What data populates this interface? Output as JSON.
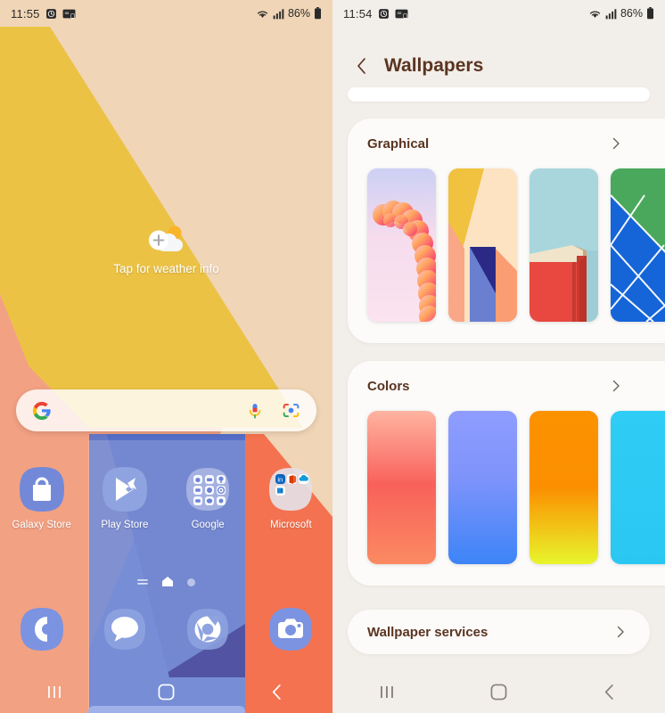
{
  "left_screen": {
    "name": "home-screen",
    "status_bar": {
      "time": "11:55",
      "battery_percent": "86%",
      "icons": [
        "alarm-icon",
        "data-saver-icon",
        "wifi-icon",
        "signal-icon",
        "battery-icon"
      ]
    },
    "weather_widget": {
      "label": "Tap for weather info",
      "icon": "weather-add-icon"
    },
    "search_bar": {
      "value": "",
      "placeholder": "",
      "icons": [
        "google-logo-icon",
        "microphone-icon",
        "google-lens-icon"
      ]
    },
    "apps": [
      {
        "label": "Galaxy Store",
        "icon": "galaxy-store-icon"
      },
      {
        "label": "Play Store",
        "icon": "play-store-icon"
      },
      {
        "label": "Google",
        "icon": "google-folder-icon"
      },
      {
        "label": "Microsoft",
        "icon": "microsoft-folder-icon"
      }
    ],
    "page_indicators": [
      "list-indicator",
      "home-indicator",
      "page-dot"
    ],
    "dock": [
      {
        "label": "Phone",
        "icon": "phone-icon"
      },
      {
        "label": "Messages",
        "icon": "messages-icon"
      },
      {
        "label": "Chrome",
        "icon": "chrome-icon"
      },
      {
        "label": "Camera",
        "icon": "camera-icon"
      }
    ],
    "nav_bar": [
      "recents-icon",
      "home-icon",
      "back-icon"
    ],
    "wallpaper_colors": {
      "beige": "#f0d5b6",
      "yellow": "#ecc245",
      "salmon": "#f2a183",
      "orange": "#f4724f",
      "navy": "#2c2f8f",
      "blue": "#5a74cc"
    }
  },
  "right_screen": {
    "name": "wallpapers-settings",
    "status_bar": {
      "time": "11:54",
      "battery_percent": "86%",
      "icons": [
        "alarm-icon",
        "data-saver-icon",
        "wifi-icon",
        "signal-icon",
        "battery-icon"
      ]
    },
    "header": {
      "title": "Wallpapers",
      "back_label": "Back"
    },
    "sections": [
      {
        "title": "Graphical",
        "chevron": "chevron-right-icon",
        "thumbnails": [
          {
            "name": "graphical-wallpaper-1",
            "description": "pink-gradient-arc"
          },
          {
            "name": "graphical-wallpaper-2",
            "description": "yellow-navy-diagonal"
          },
          {
            "name": "graphical-wallpaper-3",
            "description": "red-book-on-blue"
          },
          {
            "name": "graphical-wallpaper-4",
            "description": "green-blue-lines"
          }
        ]
      },
      {
        "title": "Colors",
        "chevron": "chevron-right-icon",
        "swatches": [
          {
            "name": "color-swatch-1",
            "from": "#ffb4a2",
            "to": "#f97c56"
          },
          {
            "name": "color-swatch-2",
            "from": "#8f9dff",
            "to": "#4080f5"
          },
          {
            "name": "color-swatch-3",
            "from": "#fc9200",
            "to": "#e8f52c"
          },
          {
            "name": "color-swatch-4",
            "from": "#2fcdf5",
            "to": "#2fcdf5"
          }
        ]
      }
    ],
    "services_row": {
      "title": "Wallpaper services",
      "chevron": "chevron-right-icon"
    },
    "nav_bar": [
      "recents-icon",
      "home-icon",
      "back-icon"
    ],
    "theme_colors": {
      "background": "#f2eee9",
      "card": "#fcfbfa",
      "text": "#5a3420"
    }
  }
}
